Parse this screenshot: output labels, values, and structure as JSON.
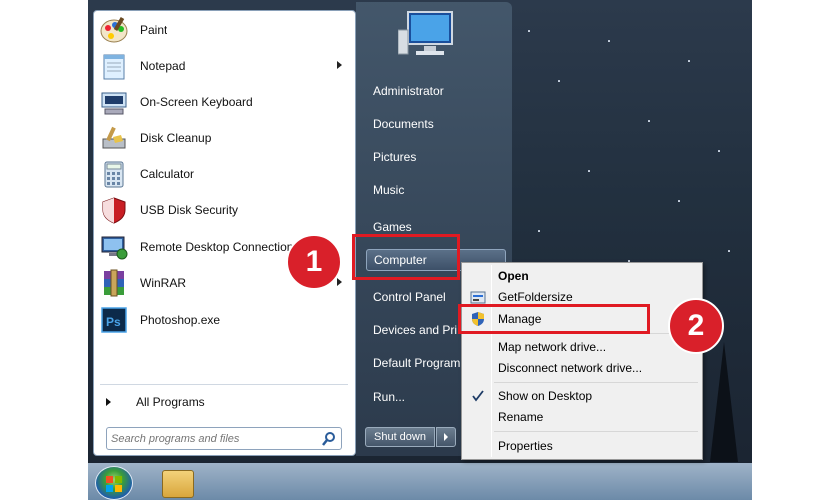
{
  "start_menu": {
    "programs": [
      {
        "label": "Paint",
        "icon": "paint-icon",
        "has_submenu": false
      },
      {
        "label": "Notepad",
        "icon": "notepad-icon",
        "has_submenu": true
      },
      {
        "label": "On-Screen Keyboard",
        "icon": "keyboard-icon",
        "has_submenu": false
      },
      {
        "label": "Disk Cleanup",
        "icon": "disk-cleanup-icon",
        "has_submenu": false
      },
      {
        "label": "Calculator",
        "icon": "calculator-icon",
        "has_submenu": false
      },
      {
        "label": "USB Disk Security",
        "icon": "shield-icon",
        "has_submenu": false
      },
      {
        "label": "Remote Desktop Connection",
        "icon": "remote-desktop-icon",
        "has_submenu": false
      },
      {
        "label": "WinRAR",
        "icon": "winrar-icon",
        "has_submenu": true
      },
      {
        "label": "Photoshop.exe",
        "icon": "photoshop-icon",
        "has_submenu": false
      }
    ],
    "all_programs_label": "All Programs",
    "search_placeholder": "Search programs and files",
    "right_items": [
      "Administrator",
      "Documents",
      "Pictures",
      "Music",
      "Games",
      "Computer",
      "Control Panel",
      "Devices and Pri",
      "Default Program",
      "Run..."
    ],
    "shutdown_label": "Shut down"
  },
  "context_menu": {
    "items": [
      {
        "label": "Open",
        "bold": true
      },
      {
        "label": "GetFoldersize",
        "icon": "folder-size-icon"
      },
      {
        "label": "Manage",
        "icon": "uac-shield-icon"
      },
      {
        "label": "Map network drive..."
      },
      {
        "label": "Disconnect network drive..."
      },
      {
        "label": "Show on Desktop",
        "checked": true
      },
      {
        "label": "Rename"
      },
      {
        "label": "Properties"
      }
    ]
  },
  "markers": [
    "1",
    "2"
  ],
  "colors": {
    "highlight": "#e01a22",
    "marker": "#d9202a"
  }
}
